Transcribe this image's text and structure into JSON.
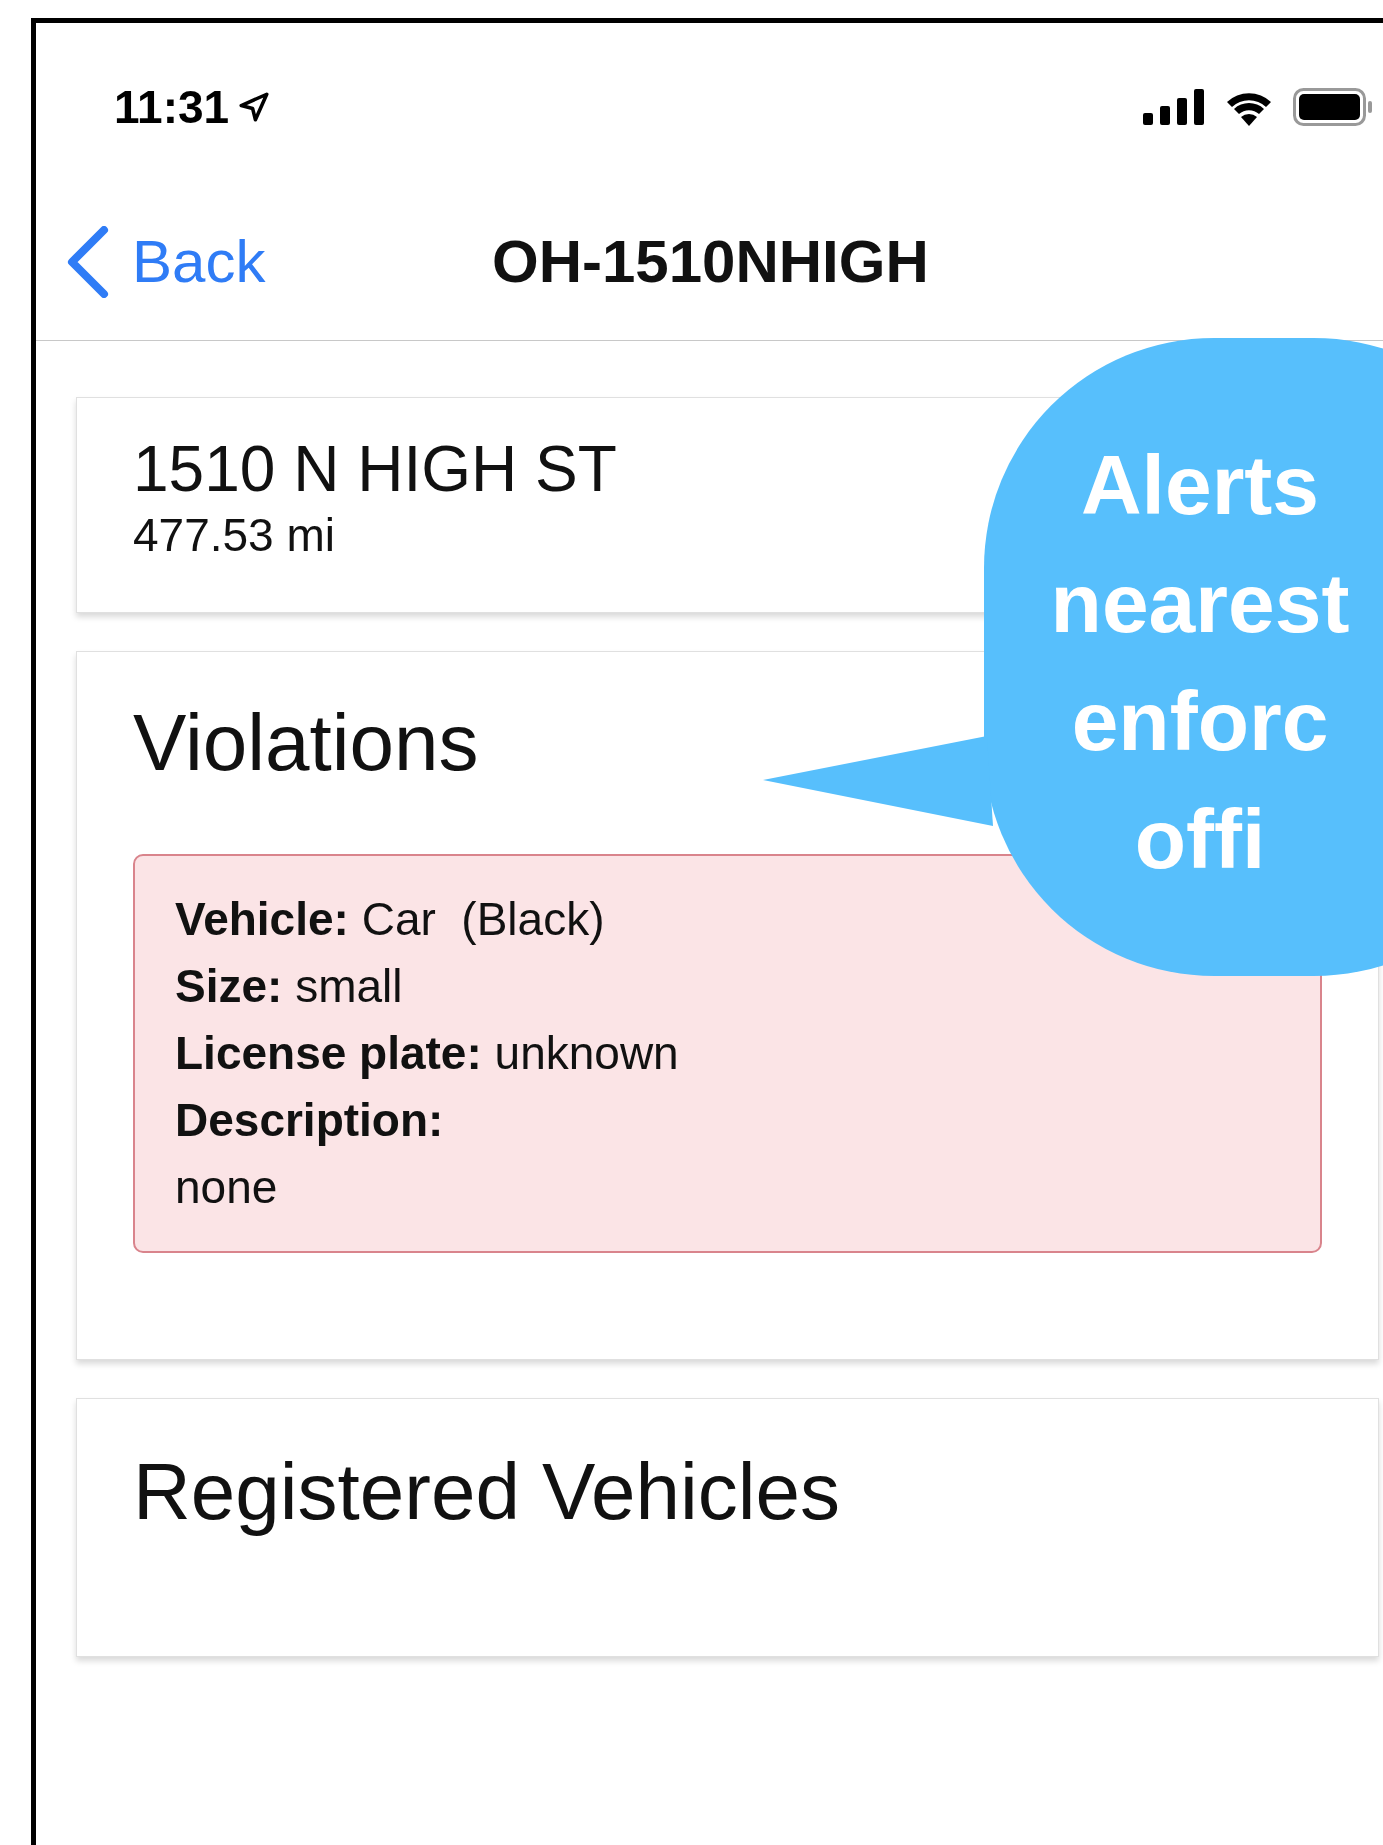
{
  "status_bar": {
    "time": "11:31"
  },
  "nav": {
    "back": "Back",
    "title": "OH-1510NHIGH"
  },
  "location": {
    "address": "1510 N HIGH ST",
    "distance": "477.53 mi"
  },
  "violations": {
    "title": "Violations",
    "items": [
      {
        "lines": [
          "**Vehicle:** Car  (Black)",
          "**Size:** small",
          "**License plate:** unknown",
          "**Description:**",
          "none"
        ]
      }
    ]
  },
  "registered_vehicles": {
    "title": "Registered Vehicles"
  },
  "callout": {
    "lines": [
      "Alerts",
      "nearest",
      "enforc",
      "offi"
    ]
  }
}
